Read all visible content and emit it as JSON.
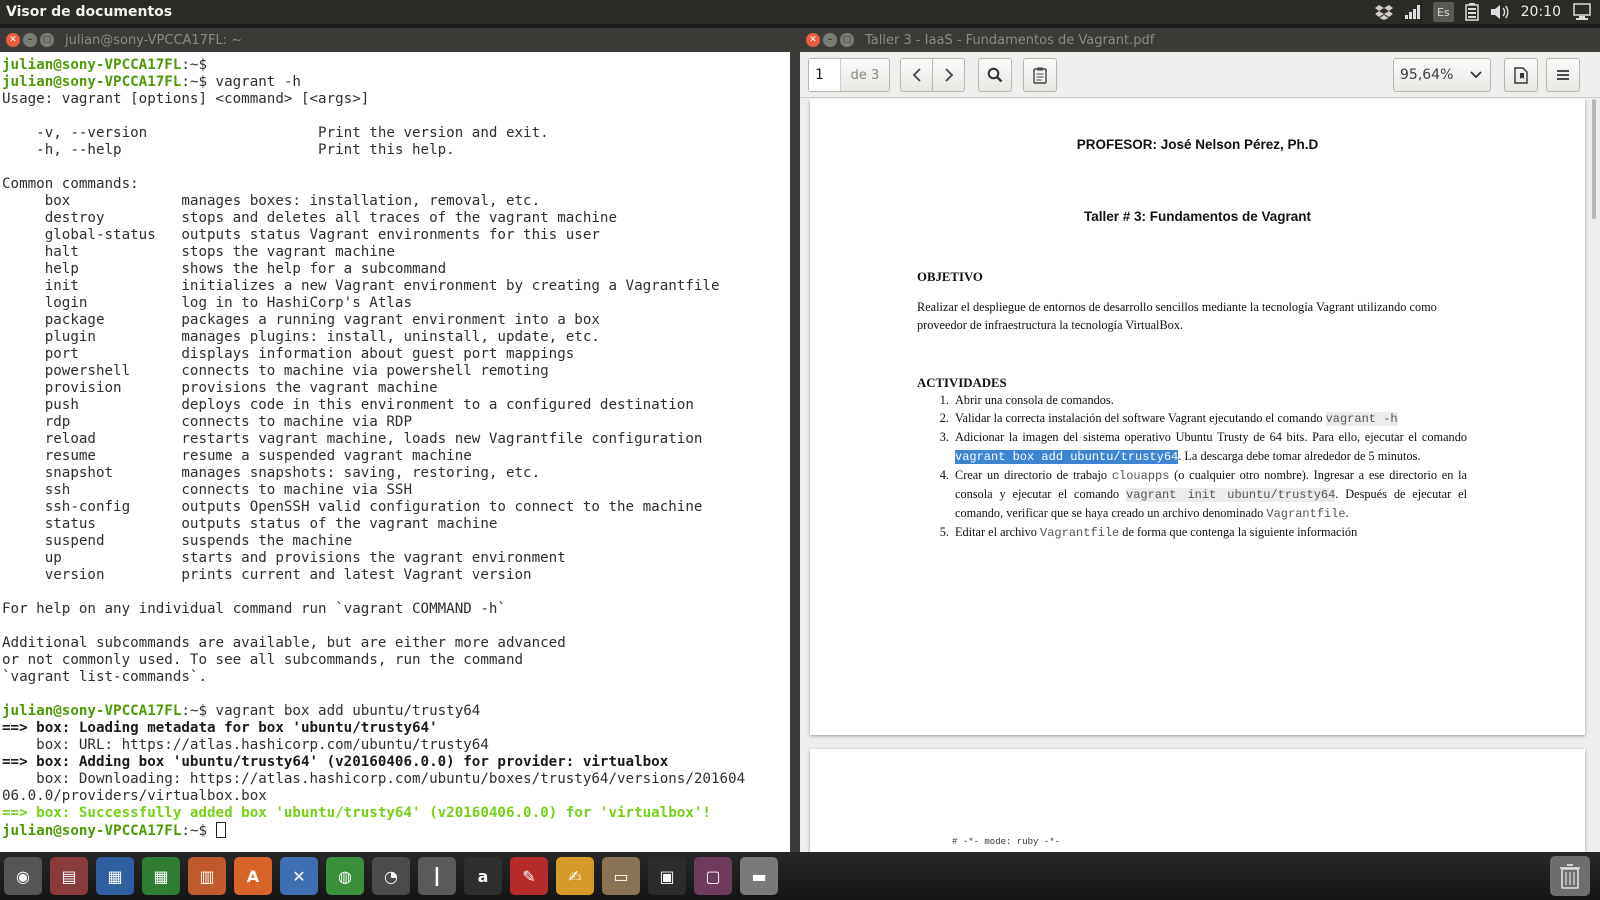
{
  "top_panel": {
    "app_title": "Visor de documentos",
    "keyboard_layout": "Es",
    "clock": "20:10",
    "icons": [
      "dropbox-icon",
      "network-signal-icon",
      "keyboard-layout-icon",
      "battery-icon",
      "volume-icon",
      "clock-label",
      "session-icon"
    ]
  },
  "terminal": {
    "title": "julian@sony-VPCCA17FL: ~",
    "lines": [
      [
        {
          "t": "julian@sony-VPCCA17FL",
          "c": "prompt"
        },
        {
          "t": ":~$ ",
          "c": ""
        }
      ],
      [
        {
          "t": "julian@sony-VPCCA17FL",
          "c": "prompt"
        },
        {
          "t": ":~$ vagrant -h",
          "c": ""
        }
      ],
      [
        {
          "t": "Usage: vagrant [options] <command> [<args>]",
          "c": ""
        }
      ],
      [
        {
          "t": "",
          "c": ""
        }
      ],
      [
        {
          "t": "    -v, --version                    Print the version and exit.",
          "c": ""
        }
      ],
      [
        {
          "t": "    -h, --help                       Print this help.",
          "c": ""
        }
      ],
      [
        {
          "t": "",
          "c": ""
        }
      ],
      [
        {
          "t": "Common commands:",
          "c": ""
        }
      ],
      [
        {
          "t": "     box             manages boxes: installation, removal, etc.",
          "c": ""
        }
      ],
      [
        {
          "t": "     destroy         stops and deletes all traces of the vagrant machine",
          "c": ""
        }
      ],
      [
        {
          "t": "     global-status   outputs status Vagrant environments for this user",
          "c": ""
        }
      ],
      [
        {
          "t": "     halt            stops the vagrant machine",
          "c": ""
        }
      ],
      [
        {
          "t": "     help            shows the help for a subcommand",
          "c": ""
        }
      ],
      [
        {
          "t": "     init            initializes a new Vagrant environment by creating a Vagrantfile",
          "c": ""
        }
      ],
      [
        {
          "t": "     login           log in to HashiCorp's Atlas",
          "c": ""
        }
      ],
      [
        {
          "t": "     package         packages a running vagrant environment into a box",
          "c": ""
        }
      ],
      [
        {
          "t": "     plugin          manages plugins: install, uninstall, update, etc.",
          "c": ""
        }
      ],
      [
        {
          "t": "     port            displays information about guest port mappings",
          "c": ""
        }
      ],
      [
        {
          "t": "     powershell      connects to machine via powershell remoting",
          "c": ""
        }
      ],
      [
        {
          "t": "     provision       provisions the vagrant machine",
          "c": ""
        }
      ],
      [
        {
          "t": "     push            deploys code in this environment to a configured destination",
          "c": ""
        }
      ],
      [
        {
          "t": "     rdp             connects to machine via RDP",
          "c": ""
        }
      ],
      [
        {
          "t": "     reload          restarts vagrant machine, loads new Vagrantfile configuration",
          "c": ""
        }
      ],
      [
        {
          "t": "     resume          resume a suspended vagrant machine",
          "c": ""
        }
      ],
      [
        {
          "t": "     snapshot        manages snapshots: saving, restoring, etc.",
          "c": ""
        }
      ],
      [
        {
          "t": "     ssh             connects to machine via SSH",
          "c": ""
        }
      ],
      [
        {
          "t": "     ssh-config      outputs OpenSSH valid configuration to connect to the machine",
          "c": ""
        }
      ],
      [
        {
          "t": "     status          outputs status of the vagrant machine",
          "c": ""
        }
      ],
      [
        {
          "t": "     suspend         suspends the machine",
          "c": ""
        }
      ],
      [
        {
          "t": "     up              starts and provisions the vagrant environment",
          "c": ""
        }
      ],
      [
        {
          "t": "     version         prints current and latest Vagrant version",
          "c": ""
        }
      ],
      [
        {
          "t": "",
          "c": ""
        }
      ],
      [
        {
          "t": "For help on any individual command run `vagrant COMMAND -h`",
          "c": ""
        }
      ],
      [
        {
          "t": "",
          "c": ""
        }
      ],
      [
        {
          "t": "Additional subcommands are available, but are either more advanced",
          "c": ""
        }
      ],
      [
        {
          "t": "or not commonly used. To see all subcommands, run the command",
          "c": ""
        }
      ],
      [
        {
          "t": "`vagrant list-commands`.",
          "c": ""
        }
      ],
      [
        {
          "t": "",
          "c": ""
        }
      ],
      [
        {
          "t": "julian@sony-VPCCA17FL",
          "c": "prompt"
        },
        {
          "t": ":~$ vagrant box add ubuntu/trusty64",
          "c": ""
        }
      ],
      [
        {
          "t": "==> ",
          "c": "arrow"
        },
        {
          "t": "box: Loading metadata for box 'ubuntu/trusty64'",
          "c": "bold"
        }
      ],
      [
        {
          "t": "    box: URL: https://atlas.hashicorp.com/ubuntu/trusty64",
          "c": ""
        }
      ],
      [
        {
          "t": "==> ",
          "c": "arrow"
        },
        {
          "t": "box: Adding box 'ubuntu/trusty64' (v20160406.0.0) for provider: virtualbox",
          "c": "bold"
        }
      ],
      [
        {
          "t": "    box: Downloading: https://atlas.hashicorp.com/ubuntu/boxes/trusty64/versions/201604",
          "c": ""
        }
      ],
      [
        {
          "t": "06.0.0/providers/virtualbox.box",
          "c": ""
        }
      ],
      [
        {
          "t": "==> box: Successfully added box 'ubuntu/trusty64' (v20160406.0.0) for 'virtualbox'!",
          "c": "ok"
        }
      ],
      [
        {
          "t": "julian@sony-VPCCA17FL",
          "c": "prompt"
        },
        {
          "t": ":~$ ",
          "c": ""
        },
        {
          "t": "",
          "c": "cursor"
        }
      ]
    ]
  },
  "pdf_viewer": {
    "title": "Taller 3 - IaaS - Fundamentos de Vagrant.pdf",
    "toolbar": {
      "page_number": "1",
      "page_of": "de 3",
      "zoom": "95,64%"
    },
    "page1": {
      "professor": "PROFESOR: José Nelson Pérez, Ph.D",
      "doc_title": "Taller # 3: Fundamentos de Vagrant",
      "objective_heading": "OBJETIVO",
      "objective_text": "Realizar el despliegue de entornos de desarrollo sencillos mediante la tecnología Vagrant utilizando como proveedor de infraestructura la tecnología VirtualBox.",
      "activities_heading": "ACTIVIDADES",
      "activities": [
        {
          "num": "1.",
          "parts": [
            {
              "t": "Abrir una consola de comandos.",
              "c": ""
            }
          ]
        },
        {
          "num": "2.",
          "parts": [
            {
              "t": "Validar la correcta instalación del software Vagrant ejecutando el comando ",
              "c": ""
            },
            {
              "t": "vagrant -h",
              "c": "mono"
            }
          ]
        },
        {
          "num": "3.",
          "parts": [
            {
              "t": "Adicionar la imagen del sistema operativo Ubuntu Trusty de 64 bits. Para ello, ejecutar el comando ",
              "c": ""
            },
            {
              "t": "vagrant box add ubuntu/trusty64",
              "c": "mono hl"
            },
            {
              "t": ". La descarga debe tomar alrededor de 5 minutos.",
              "c": ""
            }
          ]
        },
        {
          "num": "4.",
          "parts": [
            {
              "t": "Crear un directorio de trabajo ",
              "c": ""
            },
            {
              "t": "clouapps",
              "c": "mono nobg"
            },
            {
              "t": " (o cualquier otro nombre). Ingresar a ese directorio en la consola y ejecutar el comando ",
              "c": ""
            },
            {
              "t": "vagrant init ubuntu/trusty64",
              "c": "mono"
            },
            {
              "t": ". Después de ejecutar el comando, verificar que se haya creado un archivo denominado ",
              "c": ""
            },
            {
              "t": "Vagrantfile",
              "c": "mono nobg"
            },
            {
              "t": ".",
              "c": ""
            }
          ]
        },
        {
          "num": "5.",
          "parts": [
            {
              "t": "Editar el archivo ",
              "c": ""
            },
            {
              "t": "Vagrantfile",
              "c": "mono nobg"
            },
            {
              "t": " de forma que contenga la siguiente información",
              "c": ""
            }
          ]
        }
      ]
    },
    "page2": {
      "code_line": "# -*- mode: ruby -*-"
    }
  },
  "dock": {
    "icons": [
      {
        "name": "dash-home-icon",
        "color": "#555555",
        "glyph": "◉"
      },
      {
        "name": "files-icon",
        "color": "#8a3b3b",
        "glyph": "▤"
      },
      {
        "name": "writer-icon",
        "color": "#2f5f9e",
        "glyph": "▦"
      },
      {
        "name": "calc-icon",
        "color": "#2e7d32",
        "glyph": "▦"
      },
      {
        "name": "impress-icon",
        "color": "#c0592b",
        "glyph": "▥"
      },
      {
        "name": "software-center-icon",
        "color": "#d8642a",
        "glyph": "A"
      },
      {
        "name": "system-settings-icon",
        "color": "#3f6fb0",
        "glyph": "✕"
      },
      {
        "name": "chrome-icon",
        "color": "#3a8f3a",
        "glyph": "◍"
      },
      {
        "name": "system-monitor-icon",
        "color": "#4b4b4b",
        "glyph": "◔"
      },
      {
        "name": "mixer-icon",
        "color": "#5a5a5a",
        "glyph": "┃"
      },
      {
        "name": "amazon-icon",
        "color": "#2e2e2e",
        "glyph": "a"
      },
      {
        "name": "pdf-viewer-icon",
        "color": "#b52b2b",
        "glyph": "✎"
      },
      {
        "name": "text-editor-icon",
        "color": "#d59a2a",
        "glyph": "✍"
      },
      {
        "name": "file-manager-icon",
        "color": "#8a7355",
        "glyph": "▭"
      },
      {
        "name": "terminal-icon",
        "color": "#2b2b2b",
        "glyph": "▣"
      },
      {
        "name": "virtualbox-icon",
        "color": "#6e3b5c",
        "glyph": "▢"
      },
      {
        "name": "drive-icon",
        "color": "#7a7a7a",
        "glyph": "▬"
      }
    ],
    "trash": "trash-icon"
  },
  "colors": {
    "prompt_green": "#4e9a06",
    "success_green": "#73d216",
    "selection_blue": "#3d84d4",
    "titlebar": "#3c3b37",
    "close_button": "#e95f3e"
  }
}
